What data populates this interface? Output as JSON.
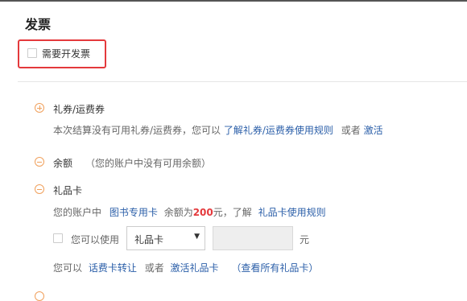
{
  "page": {
    "title": "发票"
  },
  "invoice": {
    "label": "需要开发票"
  },
  "coupon": {
    "title": "礼券/运费券",
    "desc_prefix": "本次结算没有可用礼券/运费券，您可以",
    "rules_link": "了解礼券/运费券使用规则",
    "or_text": "或者",
    "activate_link": "激活"
  },
  "balance": {
    "title": "余额",
    "note": "（您的账户中没有可用余额）"
  },
  "giftcard": {
    "title": "礼品卡",
    "account_prefix": "您的账户中",
    "card_link": "图书专用卡",
    "balance_text": "余额为",
    "balance_amount": "200",
    "unit_after": "元，了解",
    "rules_link": "礼品卡使用规则",
    "use_label": "您可以使用",
    "select_value": "礼品卡",
    "amount_placeholder": "",
    "currency_unit": "元",
    "footer_prefix": "您可以",
    "transfer_link": "话费卡转让",
    "or_text": "或者",
    "activate_link": "激活礼品卡",
    "view_all_link": "（查看所有礼品卡）"
  },
  "colors": {
    "accent_red": "#e4393c",
    "link_blue": "#2a5ea8",
    "icon_orange": "#f0a05c"
  },
  "icons": {
    "coupon": "plus-circle-icon",
    "balance": "minus-circle-icon",
    "giftcard": "minus-circle-icon",
    "select": "caret-down-icon"
  }
}
